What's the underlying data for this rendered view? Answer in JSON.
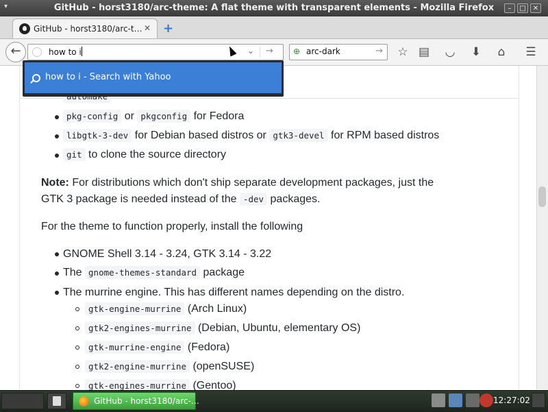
{
  "window": {
    "title": "GitHub - horst3180/arc-theme: A flat theme with transparent elements - Mozilla Firefox",
    "menu_glyph": "▾"
  },
  "tab": {
    "label": "GitHub - horst3180/arc-t…",
    "close": "✕",
    "new_tab": "+"
  },
  "navbar": {
    "url_value": "how to i",
    "search_engine_value": "arc-dark"
  },
  "popup": {
    "suggestion": "how to i - Search with Yahoo"
  },
  "content": {
    "top_partial_code": "automake",
    "deps": [
      {
        "code1": "pkg-config",
        "mid": " or ",
        "code2": "pkgconfig",
        "text": " for Fedora"
      },
      {
        "code1": "libgtk-3-dev",
        "mid": " for Debian based distros or ",
        "code2": "gtk3-devel",
        "text": " for RPM based distros"
      },
      {
        "code1": "git",
        "text": " to clone the source directory"
      }
    ],
    "note_label": "Note:",
    "note_line1": " For distributions which don't ship separate development packages, just the",
    "note_line2a": "GTK 3 package is needed instead of the ",
    "note_code": "-dev",
    "note_line2b": " packages.",
    "install_intro": "For the theme to function properly, install the following",
    "requirements": [
      {
        "text": "GNOME Shell 3.14 - 3.24, GTK 3.14 - 3.22"
      },
      {
        "pre": "The ",
        "code": "gnome-themes-standard",
        "post": " package"
      },
      {
        "text": "The murrine engine. This has different names depending on the distro."
      }
    ],
    "murrine": [
      {
        "code": "gtk-engine-murrine",
        "text": " (Arch Linux)"
      },
      {
        "code": "gtk2-engines-murrine",
        "text": " (Debian, Ubuntu, elementary OS)"
      },
      {
        "code": "gtk-murrine-engine",
        "text": " (Fedora)"
      },
      {
        "code": "gtk2-engine-murrine",
        "text": " (openSUSE)"
      },
      {
        "code": "gtk-engines-murrine",
        "text": " (Gentoo)"
      }
    ]
  },
  "taskbar": {
    "active_window": "GitHub - horst3180/arc-…",
    "clock": "12:27:02"
  },
  "colors": {
    "accent_blue": "#3c7fd6",
    "taskbar_active_green": "#4fbf4f",
    "text": "#24292e"
  }
}
